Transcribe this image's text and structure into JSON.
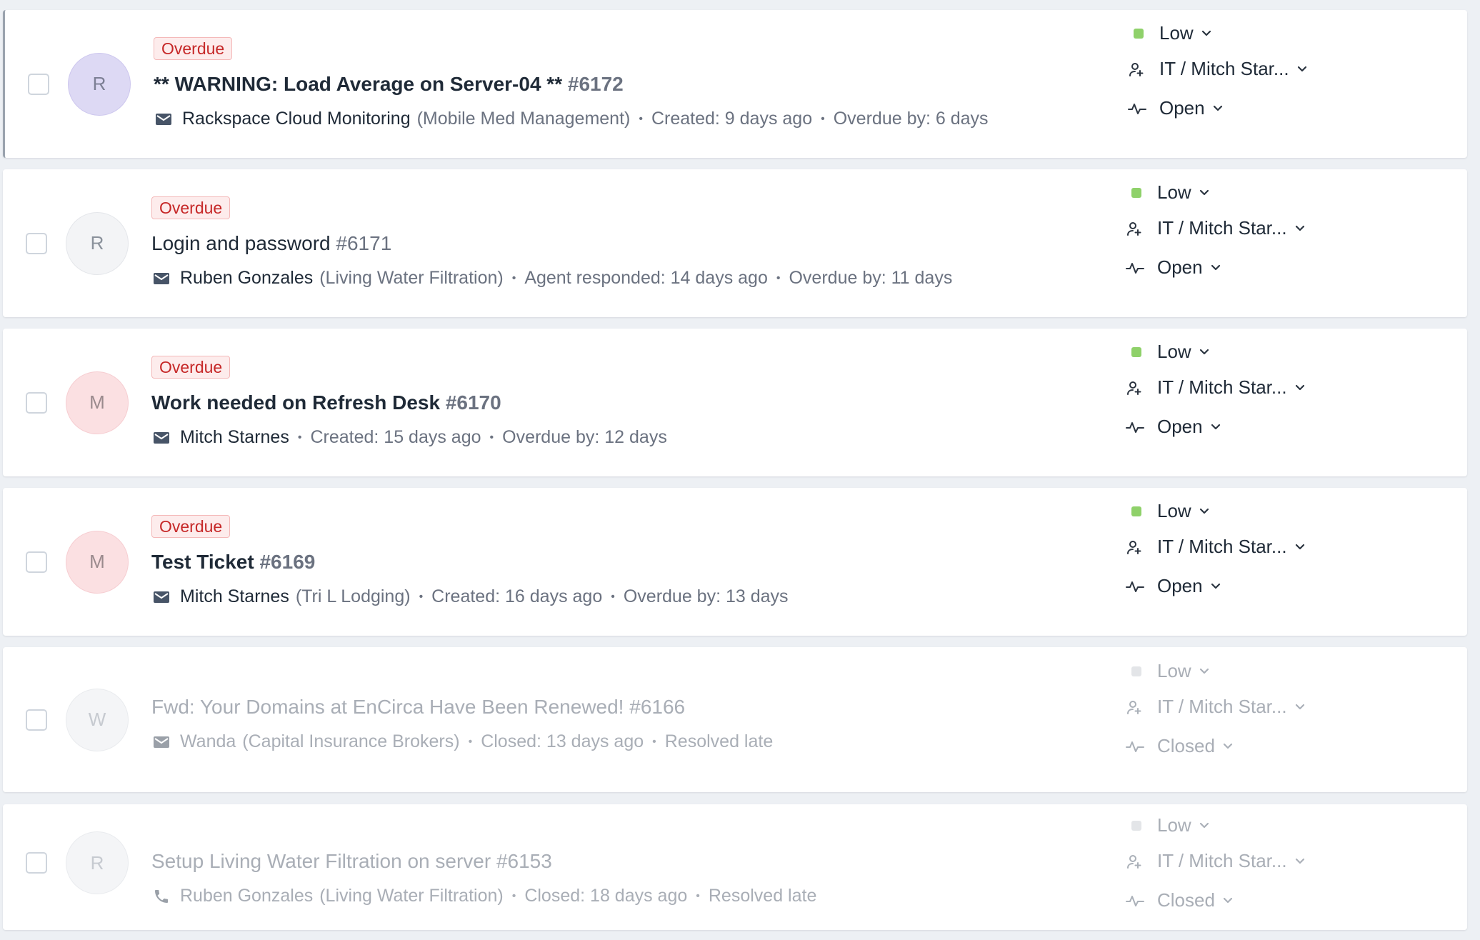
{
  "tickets": [
    {
      "avatar": "R",
      "avatar_style": "purple",
      "badge": "Overdue",
      "title": "** WARNING: Load Average on Server-04 **",
      "number": "#6172",
      "bold": true,
      "source_icon": "envelope-icon",
      "requester": "Rackspace Cloud Monitoring",
      "org": "(Mobile Med Management)",
      "details": [
        "Created: 9 days ago",
        "Overdue by: 6 days"
      ],
      "priority": "Low",
      "priority_color": "#8fd16a",
      "assignee": "IT / Mitch Star...",
      "status": "Open",
      "state": "open",
      "selected": true
    },
    {
      "avatar": "R",
      "avatar_style": "gray",
      "badge": "Overdue",
      "title": "Login and password",
      "number": "#6171",
      "bold": false,
      "source_icon": "envelope-icon",
      "requester": "Ruben Gonzales",
      "org": "(Living Water Filtration)",
      "details": [
        "Agent responded: 14 days ago",
        "Overdue by: 11 days"
      ],
      "priority": "Low",
      "priority_color": "#8fd16a",
      "assignee": "IT / Mitch Star...",
      "status": "Open",
      "state": "open",
      "selected": false
    },
    {
      "avatar": "M",
      "avatar_style": "pink",
      "badge": "Overdue",
      "title": "Work needed on Refresh Desk",
      "number": "#6170",
      "bold": true,
      "source_icon": "envelope-icon",
      "requester": "Mitch Starnes",
      "org": "",
      "details": [
        "Created: 15 days ago",
        "Overdue by: 12 days"
      ],
      "priority": "Low",
      "priority_color": "#8fd16a",
      "assignee": "IT / Mitch Star...",
      "status": "Open",
      "state": "open",
      "selected": false
    },
    {
      "avatar": "M",
      "avatar_style": "pink",
      "badge": "Overdue",
      "title": "Test Ticket",
      "number": "#6169",
      "bold": true,
      "source_icon": "envelope-icon",
      "requester": "Mitch Starnes",
      "org": "(Tri L Lodging)",
      "details": [
        "Created: 16 days ago",
        "Overdue by: 13 days"
      ],
      "priority": "Low",
      "priority_color": "#8fd16a",
      "assignee": "IT / Mitch Star...",
      "status": "Open",
      "state": "open",
      "selected": false
    },
    {
      "avatar": "W",
      "avatar_style": "faded",
      "badge": "",
      "title": "Fwd: Your Domains at EnCirca Have Been Renewed!",
      "number": "#6166",
      "bold": false,
      "source_icon": "envelope-icon",
      "requester": "Wanda",
      "org": "(Capital Insurance Brokers)",
      "details": [
        "Closed: 13 days ago",
        "Resolved late"
      ],
      "priority": "Low",
      "priority_color": "#e3e5e8",
      "assignee": "IT / Mitch Star...",
      "status": "Closed",
      "state": "closed",
      "selected": false
    },
    {
      "avatar": "R",
      "avatar_style": "faded",
      "badge": "",
      "title": "Setup Living Water Filtration on server",
      "number": "#6153",
      "bold": false,
      "source_icon": "phone-icon",
      "requester": "Ruben Gonzales",
      "org": "(Living Water Filtration)",
      "details": [
        "Closed: 18 days ago",
        "Resolved late"
      ],
      "priority": "Low",
      "priority_color": "#e3e5e8",
      "assignee": "IT / Mitch Star...",
      "status": "Closed",
      "state": "closed",
      "selected": false
    }
  ]
}
